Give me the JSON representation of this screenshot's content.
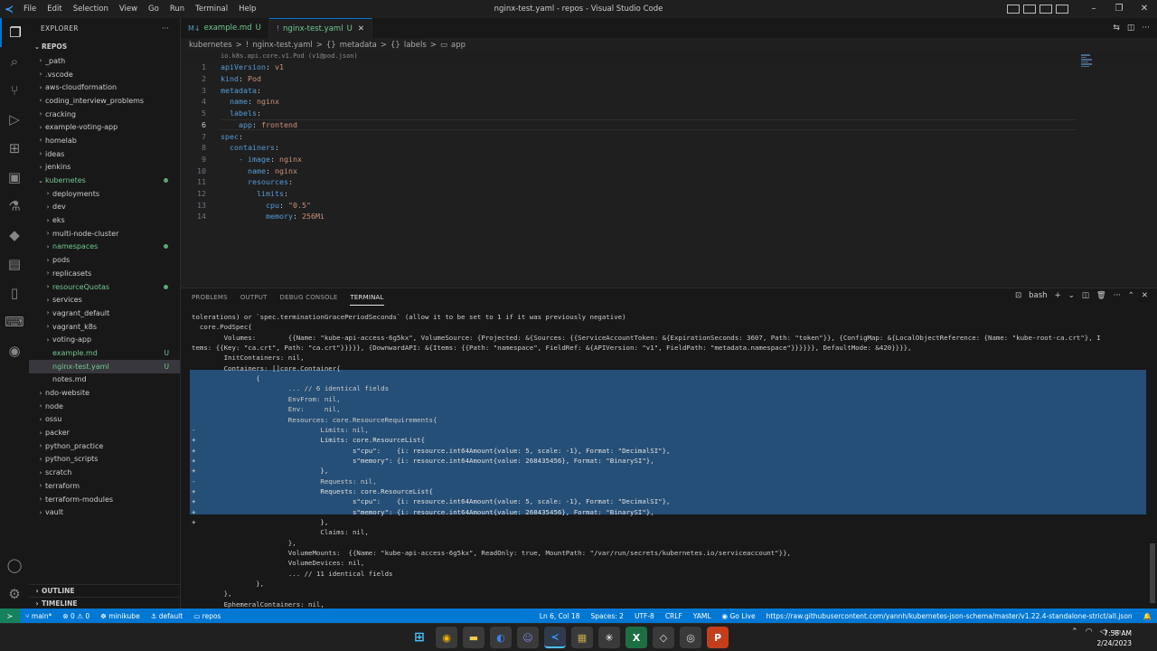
{
  "window": {
    "title": "nginx-test.yaml - repos - Visual Studio Code",
    "menu": [
      "File",
      "Edit",
      "Selection",
      "View",
      "Go",
      "Run",
      "Terminal",
      "Help"
    ]
  },
  "sidebar": {
    "header": "EXPLORER",
    "root": "REPOS",
    "items": [
      {
        "label": "_path",
        "depth": 0,
        "chev": "›"
      },
      {
        "label": ".vscode",
        "depth": 0,
        "chev": "›"
      },
      {
        "label": "aws-cloudformation",
        "depth": 0,
        "chev": "›"
      },
      {
        "label": "coding_interview_problems",
        "depth": 0,
        "chev": "›"
      },
      {
        "label": "cracking",
        "depth": 0,
        "chev": "›"
      },
      {
        "label": "example-voting-app",
        "depth": 0,
        "chev": "›"
      },
      {
        "label": "homelab",
        "depth": 0,
        "chev": "›"
      },
      {
        "label": "ideas",
        "depth": 0,
        "chev": "›"
      },
      {
        "label": "jenkins",
        "depth": 0,
        "chev": "›"
      },
      {
        "label": "kubernetes",
        "depth": 0,
        "chev": "⌄",
        "modified": true
      },
      {
        "label": "deployments",
        "depth": 1,
        "chev": "›"
      },
      {
        "label": "dev",
        "depth": 1,
        "chev": "›"
      },
      {
        "label": "eks",
        "depth": 1,
        "chev": "›"
      },
      {
        "label": "multi-node-cluster",
        "depth": 1,
        "chev": "›"
      },
      {
        "label": "namespaces",
        "depth": 1,
        "chev": "›",
        "modified": true
      },
      {
        "label": "pods",
        "depth": 1,
        "chev": "›"
      },
      {
        "label": "replicasets",
        "depth": 1,
        "chev": "›"
      },
      {
        "label": "resourceQuotas",
        "depth": 1,
        "chev": "›",
        "modified": true
      },
      {
        "label": "services",
        "depth": 1,
        "chev": "›"
      },
      {
        "label": "vagrant_default",
        "depth": 1,
        "chev": "›"
      },
      {
        "label": "vagrant_k8s",
        "depth": 1,
        "chev": "›"
      },
      {
        "label": "voting-app",
        "depth": 1,
        "chev": "›"
      },
      {
        "label": "example.md",
        "depth": 1,
        "chev": "",
        "badge": "U"
      },
      {
        "label": "nginx-test.yaml",
        "depth": 1,
        "chev": "",
        "badge": "U",
        "selected": true
      },
      {
        "label": "notes.md",
        "depth": 1,
        "chev": ""
      },
      {
        "label": "ndo-website",
        "depth": 0,
        "chev": "›"
      },
      {
        "label": "node",
        "depth": 0,
        "chev": "›"
      },
      {
        "label": "ossu",
        "depth": 0,
        "chev": "›"
      },
      {
        "label": "packer",
        "depth": 0,
        "chev": "›"
      },
      {
        "label": "python_practice",
        "depth": 0,
        "chev": "›"
      },
      {
        "label": "python_scripts",
        "depth": 0,
        "chev": "›"
      },
      {
        "label": "scratch",
        "depth": 0,
        "chev": "›"
      },
      {
        "label": "terraform",
        "depth": 0,
        "chev": "›"
      },
      {
        "label": "terraform-modules",
        "depth": 0,
        "chev": "›"
      },
      {
        "label": "vault",
        "depth": 0,
        "chev": "›"
      }
    ],
    "outline": "OUTLINE",
    "timeline": "TIMELINE"
  },
  "tabs": [
    {
      "label": "example.md",
      "mod": "U",
      "icon": "M↓",
      "active": false
    },
    {
      "label": "nginx-test.yaml",
      "mod": "U",
      "icon": "!",
      "active": true
    }
  ],
  "breadcrumb": [
    "kubernetes",
    ">",
    "!",
    "nginx-test.yaml",
    ">",
    "{}",
    "metadata",
    ">",
    "{}",
    "labels",
    ">",
    "▭",
    "app"
  ],
  "schema_hint": "io.k8s.api.core.v1.Pod (v1@pod.json)",
  "code": [
    {
      "n": "1",
      "indent": 0,
      "key": "apiVersion",
      "val": "v1"
    },
    {
      "n": "2",
      "indent": 0,
      "key": "kind",
      "val": "Pod"
    },
    {
      "n": "3",
      "indent": 0,
      "key": "metadata",
      "val": ""
    },
    {
      "n": "4",
      "indent": 1,
      "key": "name",
      "val": "nginx"
    },
    {
      "n": "5",
      "indent": 1,
      "key": "labels",
      "val": ""
    },
    {
      "n": "6",
      "indent": 2,
      "key": "app",
      "val": "frontend"
    },
    {
      "n": "7",
      "indent": 0,
      "key": "spec",
      "val": ""
    },
    {
      "n": "8",
      "indent": 1,
      "key": "containers",
      "val": ""
    },
    {
      "n": "9",
      "indent": 2,
      "key": "- image",
      "val": "nginx"
    },
    {
      "n": "10",
      "indent": 3,
      "key": "name",
      "val": "nginx"
    },
    {
      "n": "11",
      "indent": 3,
      "key": "resources",
      "val": ""
    },
    {
      "n": "12",
      "indent": 4,
      "key": "limits",
      "val": ""
    },
    {
      "n": "13",
      "indent": 5,
      "key": "cpu",
      "val": "\"0.5\""
    },
    {
      "n": "14",
      "indent": 5,
      "key": "memory",
      "val": "256Mi"
    }
  ],
  "panel": {
    "tabs": [
      "PROBLEMS",
      "OUTPUT",
      "DEBUG CONSOLE",
      "TERMINAL"
    ],
    "shell": "bash",
    "terminal_lines": [
      "tolerations) or `spec.terminationGracePeriodSeconds` (allow it to be set to 1 if it was previously negative)",
      "  core.PodSpec{",
      "        Volumes:        {{Name: \"kube-api-access-6g5kx\", VolumeSource: {Projected: &{Sources: {{ServiceAccountToken: &{ExpirationSeconds: 3607, Path: \"token\"}}, {ConfigMap: &{LocalObjectReference: {Name: \"kube-root-ca.crt\"}, I",
      "tems: {{Key: \"ca.crt\", Path: \"ca.crt\"}}}}}, {DownwardAPI: &{Items: {{Path: \"namespace\", FieldRef: &{APIVersion: \"v1\", FieldPath: \"metadata.namespace\"}}}}}}, DefaultMode: &420}}}},",
      "        InitContainers: nil,",
      "        Containers: []core.Container{",
      "                {",
      "                        ... // 6 identical fields",
      "                        EnvFrom: nil,",
      "                        Env:     nil,",
      "                        Resources: core.ResourceRequirements{",
      "-                               Limits: nil,",
      "+                               Limits: core.ResourceList{",
      "+                                       s\"cpu\":    {i: resource.int64Amount{value: 5, scale: -1}, Format: \"DecimalSI\"},",
      "+                                       s\"memory\": {i: resource.int64Amount{value: 268435456}, Format: \"BinarySI\"},",
      "+                               },",
      "-                               Requests: nil,",
      "+                               Requests: core.ResourceList{",
      "+                                       s\"cpu\":    {i: resource.int64Amount{value: 5, scale: -1}, Format: \"DecimalSI\"},",
      "+                                       s\"memory\": {i: resource.int64Amount{value: 268435456}, Format: \"BinarySI\"},",
      "+                               },",
      "                                Claims: nil,",
      "                        },",
      "                        VolumeMounts:  {{Name: \"kube-api-access-6g5kx\", ReadOnly: true, MountPath: \"/var/run/secrets/kubernetes.io/serviceaccount\"}},",
      "                        VolumeDevices: nil,",
      "                        ... // 11 identical fields",
      "                },",
      "        },",
      "        EphemeralContainers: nil,"
    ]
  },
  "statusbar": {
    "left": [
      "main*",
      "⊗ 0 ⚠ 0",
      "minikube",
      "default",
      "repos"
    ],
    "right": [
      "Ln 6, Col 18",
      "Spaces: 2",
      "UTF-8",
      "CRLF",
      "YAML",
      "Go Live",
      "https://raw.githubusercontent.com/yannh/kubernetes-json-schema/master/v1.22.4-standalone-strict/all.json"
    ]
  },
  "taskbar": {
    "time": "7:58 AM",
    "date": "2/24/2023"
  },
  "colors": {
    "accent": "#0078d4",
    "remote": "#16825d",
    "selection": "#264f78",
    "git_added": "#73c991"
  }
}
